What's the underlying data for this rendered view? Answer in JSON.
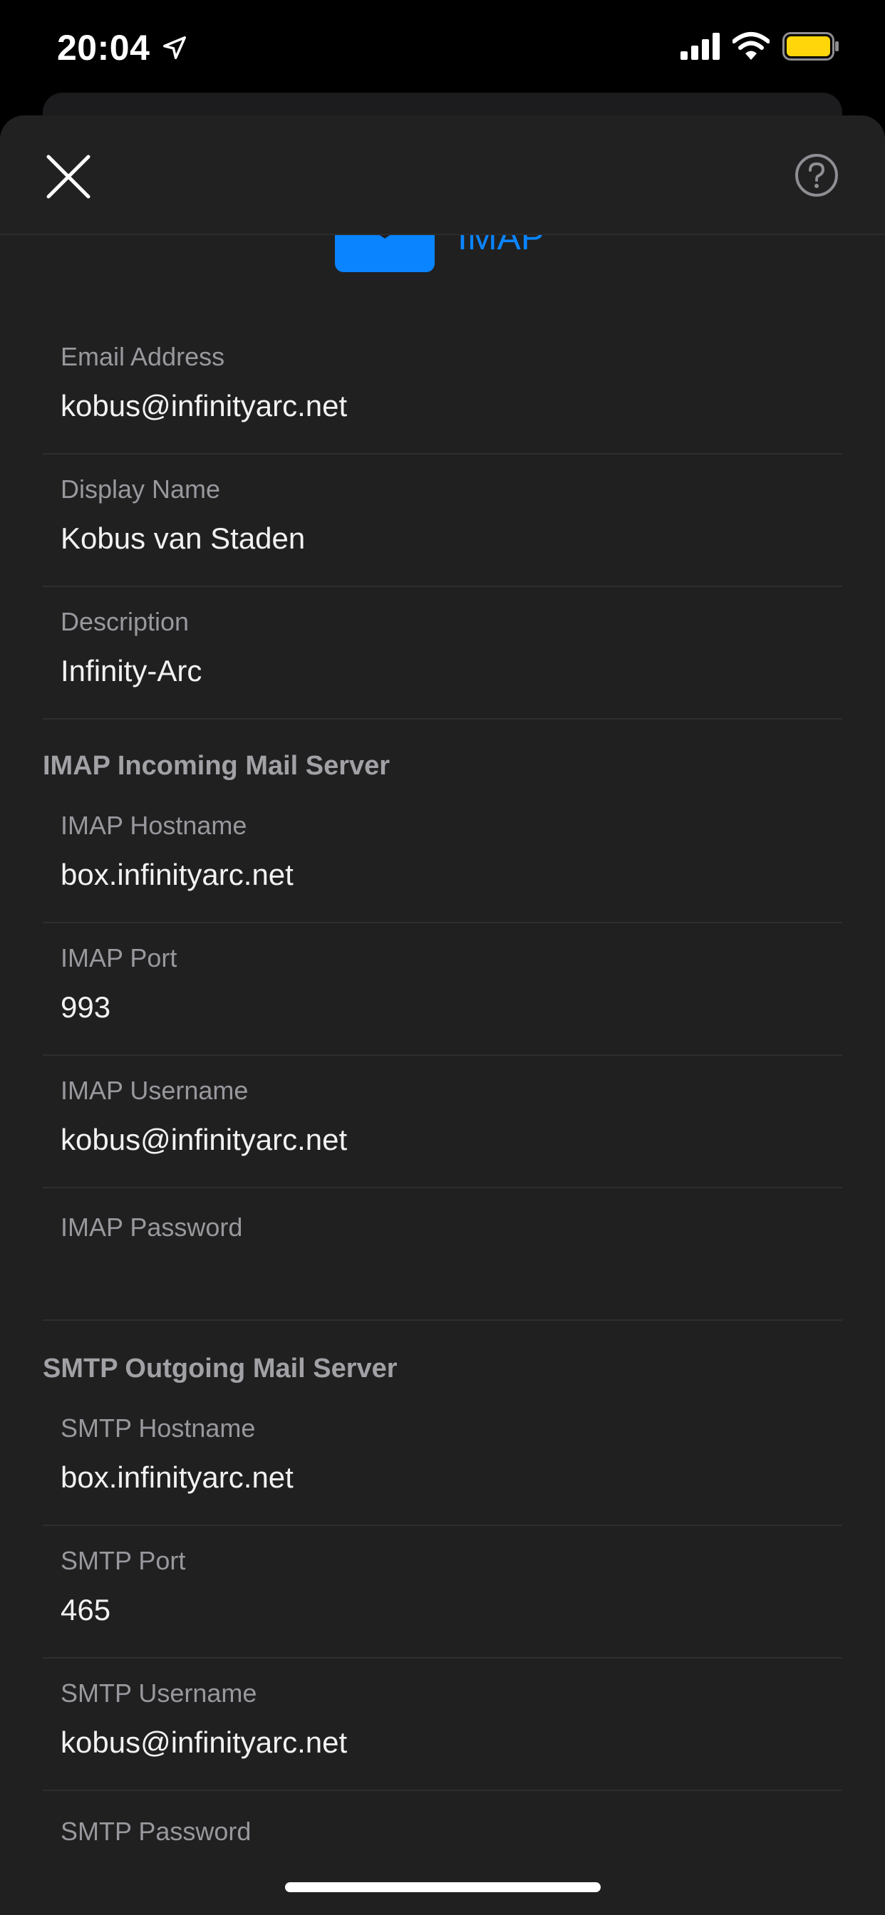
{
  "status_bar": {
    "time": "20:04"
  },
  "provider": {
    "name": "IMAP",
    "accent_color": "#0a84ff"
  },
  "account": {
    "email": {
      "label": "Email Address",
      "value": "kobus@infinityarc.net"
    },
    "display_name": {
      "label": "Display Name",
      "value": "Kobus van Staden"
    },
    "description": {
      "label": "Description",
      "value": "Infinity-Arc"
    }
  },
  "incoming": {
    "section_title": "IMAP Incoming Mail Server",
    "hostname": {
      "label": "IMAP Hostname",
      "value": "box.infinityarc.net"
    },
    "port": {
      "label": "IMAP Port",
      "value": "993"
    },
    "username": {
      "label": "IMAP Username",
      "value": "kobus@infinityarc.net"
    },
    "password": {
      "label": "IMAP Password",
      "value": ""
    }
  },
  "outgoing": {
    "section_title": "SMTP Outgoing Mail Server",
    "hostname": {
      "label": "SMTP Hostname",
      "value": "box.infinityarc.net"
    },
    "port": {
      "label": "SMTP Port",
      "value": "465"
    },
    "username": {
      "label": "SMTP Username",
      "value": "kobus@infinityarc.net"
    },
    "password": {
      "label": "SMTP Password",
      "value": ""
    }
  }
}
